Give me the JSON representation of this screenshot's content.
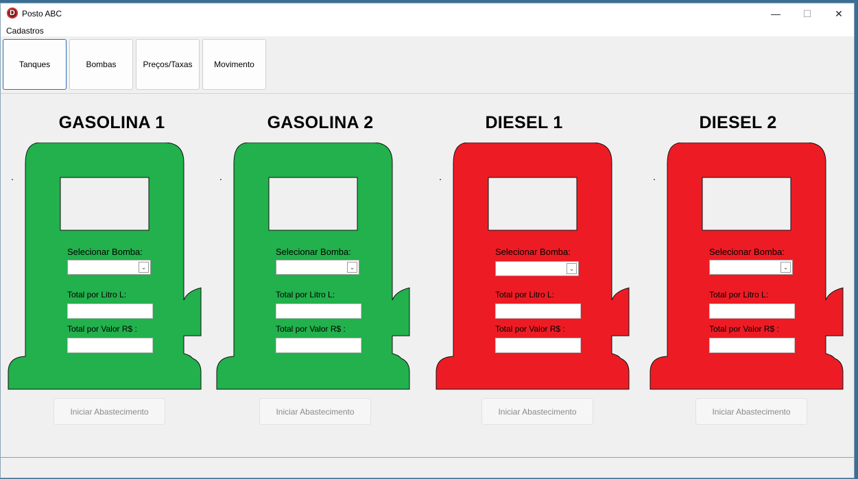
{
  "window": {
    "title": "Posto ABC",
    "app_icon": "D",
    "controls": {
      "minimize": "—",
      "maximize": "☐",
      "close": "✕"
    }
  },
  "menu": {
    "items": [
      "Cadastros"
    ]
  },
  "tabs": [
    {
      "label": "Tanques",
      "active": true
    },
    {
      "label": "Bombas",
      "active": false
    },
    {
      "label": "Preços/Taxas",
      "active": false
    },
    {
      "label": "Movimento",
      "active": false
    }
  ],
  "colors": {
    "gasoline": "#22b14c",
    "diesel": "#ed1c24"
  },
  "pumps": [
    {
      "title": "GASOLINA 1",
      "fuel": "gasoline",
      "select_label": "Selecionar Bomba:",
      "selected": "",
      "liters_label": "Total por Litro L:",
      "liters_value": "",
      "value_label": "Total por Valor R$ :",
      "value_value": "",
      "button_label": "Iniciar Abastecimento"
    },
    {
      "title": "GASOLINA 2",
      "fuel": "gasoline",
      "select_label": "Selecionar Bomba:",
      "selected": "",
      "liters_label": "Total por Litro L:",
      "liters_value": "",
      "value_label": "Total por Valor R$ :",
      "value_value": "",
      "button_label": "Iniciar Abastecimento"
    },
    {
      "title": "DIESEL 1",
      "fuel": "diesel",
      "select_label": "Selecionar Bomba:",
      "selected": "",
      "liters_label": "Total por Litro L:",
      "liters_value": "",
      "value_label": "Total por Valor R$ :",
      "value_value": "",
      "button_label": "Iniciar Abastecimento"
    },
    {
      "title": "DIESEL 2",
      "fuel": "diesel",
      "select_label": "Selecionar Bomba:",
      "selected": "",
      "liters_label": "Total por Litro L:",
      "liters_value": "",
      "value_label": "Total por Valor R$ :",
      "value_value": "",
      "button_label": "Iniciar Abastecimento"
    }
  ]
}
